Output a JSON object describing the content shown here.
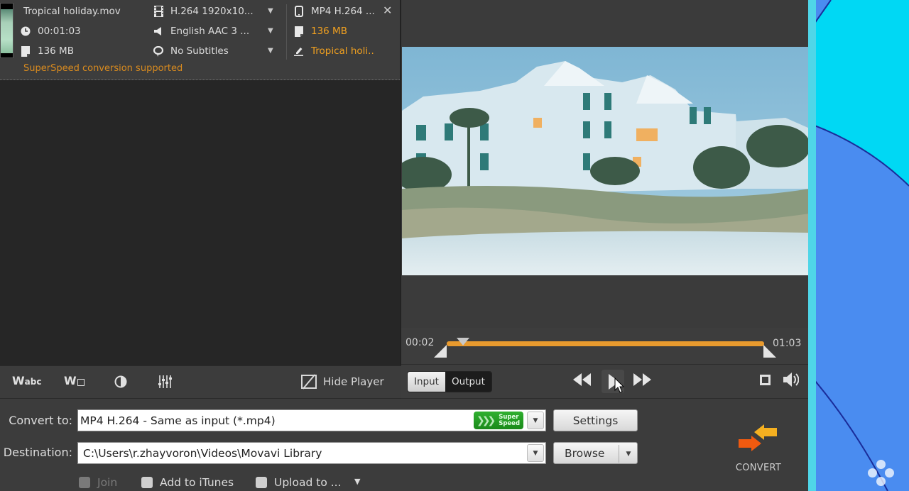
{
  "file_item": {
    "name": "Tropical holiday.mov",
    "duration": "00:01:03",
    "size": "136 MB",
    "video_track": "H.264 1920x10...",
    "audio_track": "English AAC 3 ...",
    "subtitles": "No Subtitles",
    "output_format": "MP4 H.264 ...",
    "output_size": "136 MB",
    "output_name": "Tropical holi..",
    "note": "SuperSpeed conversion supported",
    "close_glyph": "✕"
  },
  "edit_toolbar": {
    "tools": [
      {
        "name": "text-watermark",
        "glyph": "Wabc"
      },
      {
        "name": "image-watermark",
        "glyph": "W"
      },
      {
        "name": "adjust-colors",
        "glyph": "◑"
      },
      {
        "name": "equalizer",
        "glyph": "⫶"
      }
    ],
    "hide_player_label": "Hide Player"
  },
  "player": {
    "time_start": "00:02",
    "time_end": "01:03",
    "input_label": "Input",
    "output_label": "Output",
    "rewind_glyph": "◀◀",
    "forward_glyph": "▶▶",
    "volume_glyph": "🔊"
  },
  "settings": {
    "convert_to_label": "Convert to:",
    "convert_to_value": "MP4 H.264 - Same as input (*.mp4)",
    "superspeed_line1": "Super",
    "superspeed_line2": "Speed",
    "settings_button": "Settings",
    "destination_label": "Destination:",
    "destination_value": "C:\\Users\\r.zhayvoron\\Videos\\Movavi Library",
    "browse_button": "Browse",
    "dropdown_glyph": "▼",
    "join_label": "Join",
    "itunes_label": "Add to iTunes",
    "upload_label": "Upload to ...",
    "convert_label": "CONVERT"
  },
  "colors": {
    "accent_orange": "#e89a2e",
    "note_orange": "#d98b1f",
    "superspeed_green": "#1a8a1a",
    "desktop_blue": "#4a8cf0",
    "desktop_cyan": "#00d8f4"
  }
}
